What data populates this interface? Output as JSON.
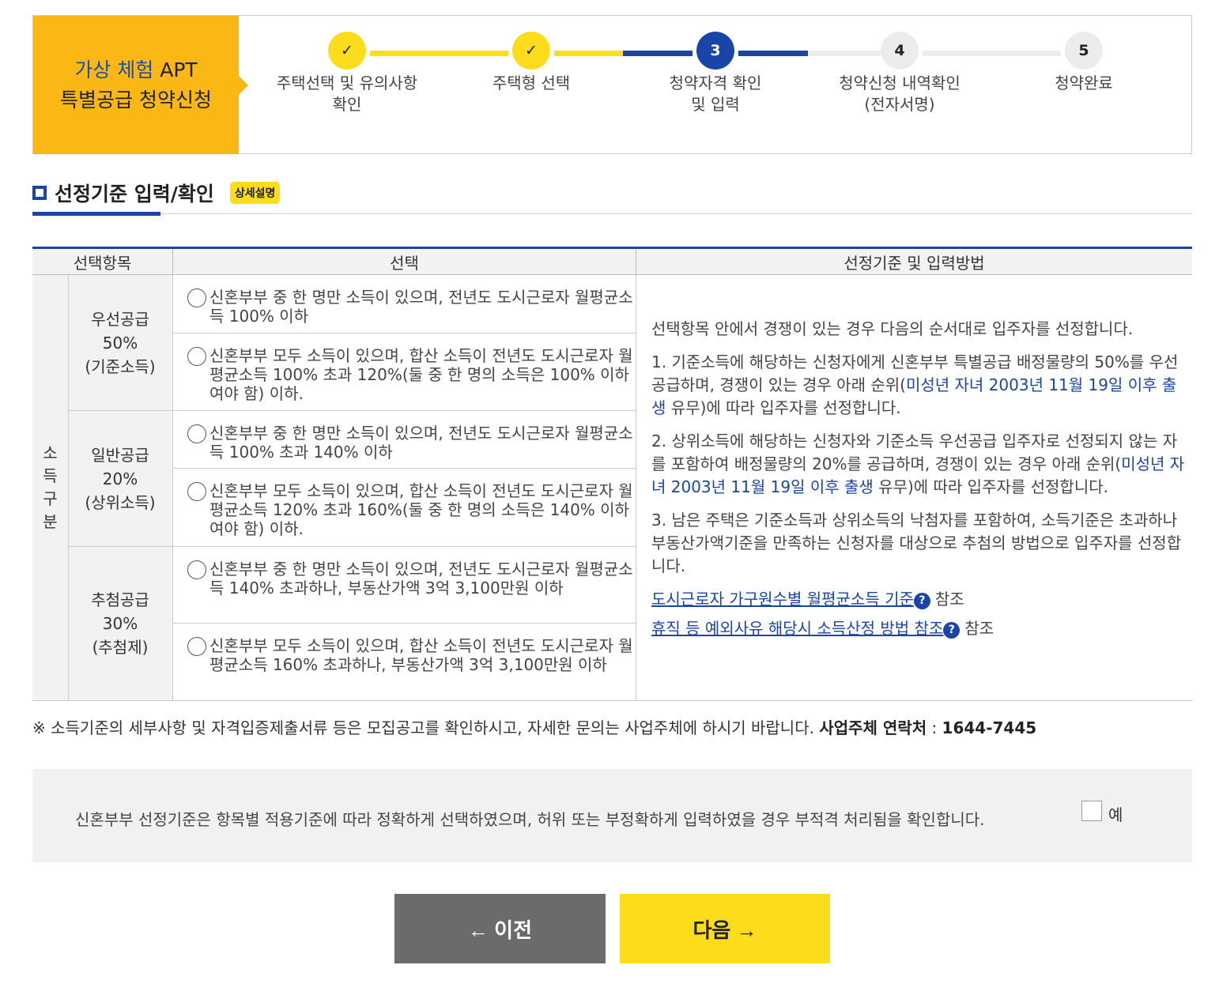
{
  "brand": {
    "line1_hl": "가상 체험",
    "line1_rest": " APT",
    "line2": "특별공급 청약신청"
  },
  "steps": [
    {
      "num": "✓",
      "label": "주택선택 및 유의사항 확인",
      "state": "done"
    },
    {
      "num": "✓",
      "label": "주택형 선택",
      "state": "done"
    },
    {
      "num": "3",
      "label": "청약자격 확인 및 입력",
      "state": "current"
    },
    {
      "num": "4",
      "label": "청약신청 내역확인 (전자서명)",
      "state": "todo"
    },
    {
      "num": "5",
      "label": "청약완료",
      "state": "todo"
    }
  ],
  "section": {
    "title": "선정기준 입력/확인",
    "badge": "상세설명"
  },
  "table": {
    "headers": [
      "선택항목",
      "선택",
      "선정기준 및 입력방법"
    ],
    "row_group": "소\n득\n구\n분",
    "categories": [
      {
        "l1": "우선공급",
        "l2": "50%",
        "l3": "(기준소득)"
      },
      {
        "l1": "일반공급",
        "l2": "20%",
        "l3": "(상위소득)"
      },
      {
        "l1": "추첨공급",
        "l2": "30%",
        "l3": "(추첨제)"
      }
    ],
    "options": [
      "신혼부부 중 한 명만 소득이 있으며, 전년도 도시근로자 월평균소득 100% 이하",
      "신혼부부 모두 소득이 있으며, 합산 소득이 전년도 도시근로자 월평균소득 100% 초과 120%(둘 중 한 명의 소득은 100% 이하여야 함) 이하.",
      "신혼부부 중 한 명만 소득이 있으며, 전년도 도시근로자 월평균소득 100% 초과 140% 이하",
      "신혼부부 모두 소득이 있으며, 합산 소득이 전년도 도시근로자 월평균소득 120% 초과 160%(둘 중 한 명의 소득은 140% 이하여야 함) 이하.",
      "신혼부부 중 한 명만 소득이 있으며, 전년도 도시근로자 월평균소득 140% 초과하나, 부동산가액 3억 3,100만원 이하",
      "신혼부부 모두 소득이 있으며, 합산 소득이 전년도 도시근로자 월평균소득 160% 초과하나, 부동산가액 3억 3,100만원 이하"
    ],
    "method": {
      "intro": "선택항목 안에서 경쟁이 있는 경우 다음의 순서대로 입주자를 선정합니다.",
      "p1_a": "1. 기준소득에 해당하는 신청자에게 신혼부부 특별공급 배정물량의 50%를 우선 공급하며, 경쟁이 있는 경우 아래 순위(",
      "p1_hl": "미성년 자녀 2003년 11월 19일 이후 출생",
      "p1_b": " 유무)에 따라 입주자를 선정합니다.",
      "p2_a": "2. 상위소득에 해당하는 신청자와 기준소득 우선공급 입주자로 선정되지 않는 자를 포함하여 배정물량의 20%를 공급하며, 경쟁이 있는 경우 아래 순위(",
      "p2_hl": "미성년 자녀 2003년 11월 19일 이후 출생",
      "p2_b": " 유무)에 따라 입주자를 선정합니다.",
      "p3": "3. 남은 주택은 기준소득과 상위소득의 낙첨자를 포함하여, 소득기준은 초과하나 부동산가액기준을 만족하는 신청자를 대상으로 추첨의 방법으로 입주자를 선정합니다.",
      "link1": "도시근로자 가구원수별 월평균소득 기준",
      "link2": "휴직 등 예외사유 해당시 소득산정 방법 참조",
      "ref": "참조",
      "help": "?"
    }
  },
  "note": {
    "text": "※ 소득기준의 세부사항 및 자격입증제출서류 등은 모집공고를 확인하시고, 자세한 문의는 사업주체에 하시기 바랍니다. ",
    "contact_label": "사업주체 연락처",
    "contact_sep": " : ",
    "contact": "1644-7445"
  },
  "confirm": {
    "text": "신혼부부 선정기준은 항목별 적용기준에 따라 정확하게 선택하였으며, 허위 또는 부정확하게 입력하였을 경우 부적격 처리됨을 확인합니다.",
    "check_label": "예"
  },
  "buttons": {
    "prev": "← 이전",
    "next": "다음 →"
  },
  "colors": {
    "accent_blue": "#1a44a8",
    "yellow": "#fddc1c",
    "brand_orange": "#fbb714"
  }
}
